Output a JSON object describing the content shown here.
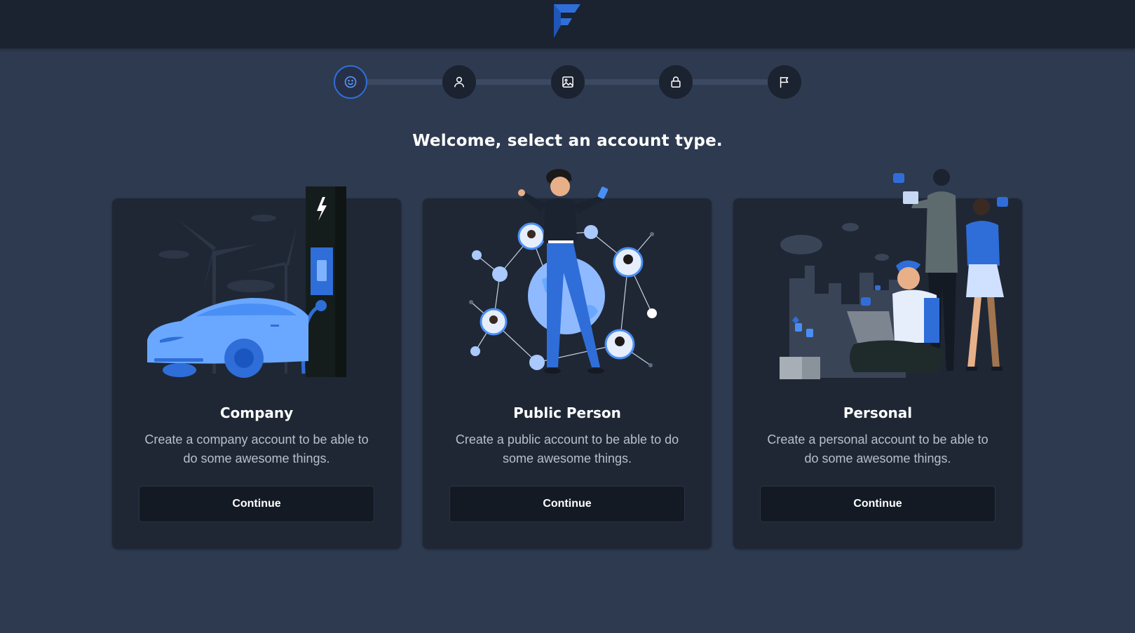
{
  "header": {
    "logo_icon": "f-logo-icon",
    "brand_color": "#2f6ed8"
  },
  "stepper": {
    "steps": [
      {
        "icon": "smiley-icon",
        "state": "active"
      },
      {
        "icon": "user-icon",
        "state": "inactive"
      },
      {
        "icon": "image-icon",
        "state": "inactive"
      },
      {
        "icon": "lock-icon",
        "state": "inactive"
      },
      {
        "icon": "flag-icon",
        "state": "inactive"
      }
    ]
  },
  "main": {
    "heading": "Welcome, select an account type."
  },
  "cards": [
    {
      "title": "Company",
      "description": "Create a company account to be able to do some awesome things.",
      "button_label": "Continue",
      "illustration": "electric-car-charging-illustration"
    },
    {
      "title": "Public Person",
      "description": "Create a public account to be able to do some awesome things.",
      "button_label": "Continue",
      "illustration": "public-network-woman-illustration"
    },
    {
      "title": "Personal",
      "description": "Create a personal account to be able to do some awesome things.",
      "button_label": "Continue",
      "illustration": "social-media-people-illustration"
    }
  ],
  "colors": {
    "page_background": "#2e3a50",
    "header_background": "#1b2230",
    "card_background": "#1f2735",
    "button_background": "#141a24",
    "accent": "#2f6ed8",
    "illustration_blue": "#5b9dff"
  }
}
